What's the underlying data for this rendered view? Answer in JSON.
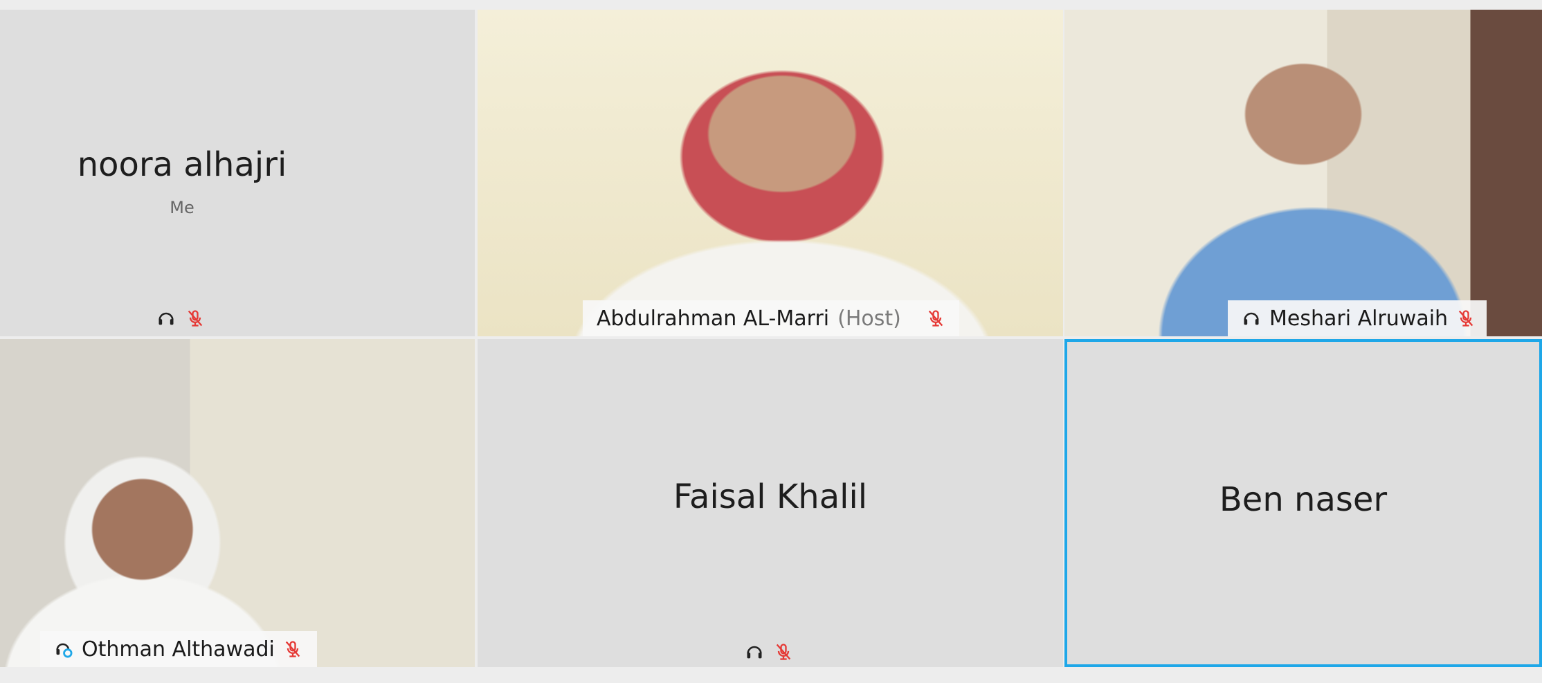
{
  "participants": [
    {
      "name": "noora alhajri",
      "sub_label": "Me"
    },
    {
      "name": "Abdulrahman AL-Marri",
      "role": "(Host)"
    },
    {
      "name": "Meshari Alruwaih"
    },
    {
      "name": "Othman Althawadi"
    },
    {
      "name": "Faisal Khalil"
    },
    {
      "name": "Ben naser"
    }
  ],
  "icons": {
    "audio": "headphones-icon",
    "mic_muted": "mic-muted-icon",
    "connection": "connection-icon"
  },
  "colors": {
    "active_speaker_border": "#1ea7e8",
    "muted_mic": "#e53935",
    "tile_bg": "#dedede"
  }
}
